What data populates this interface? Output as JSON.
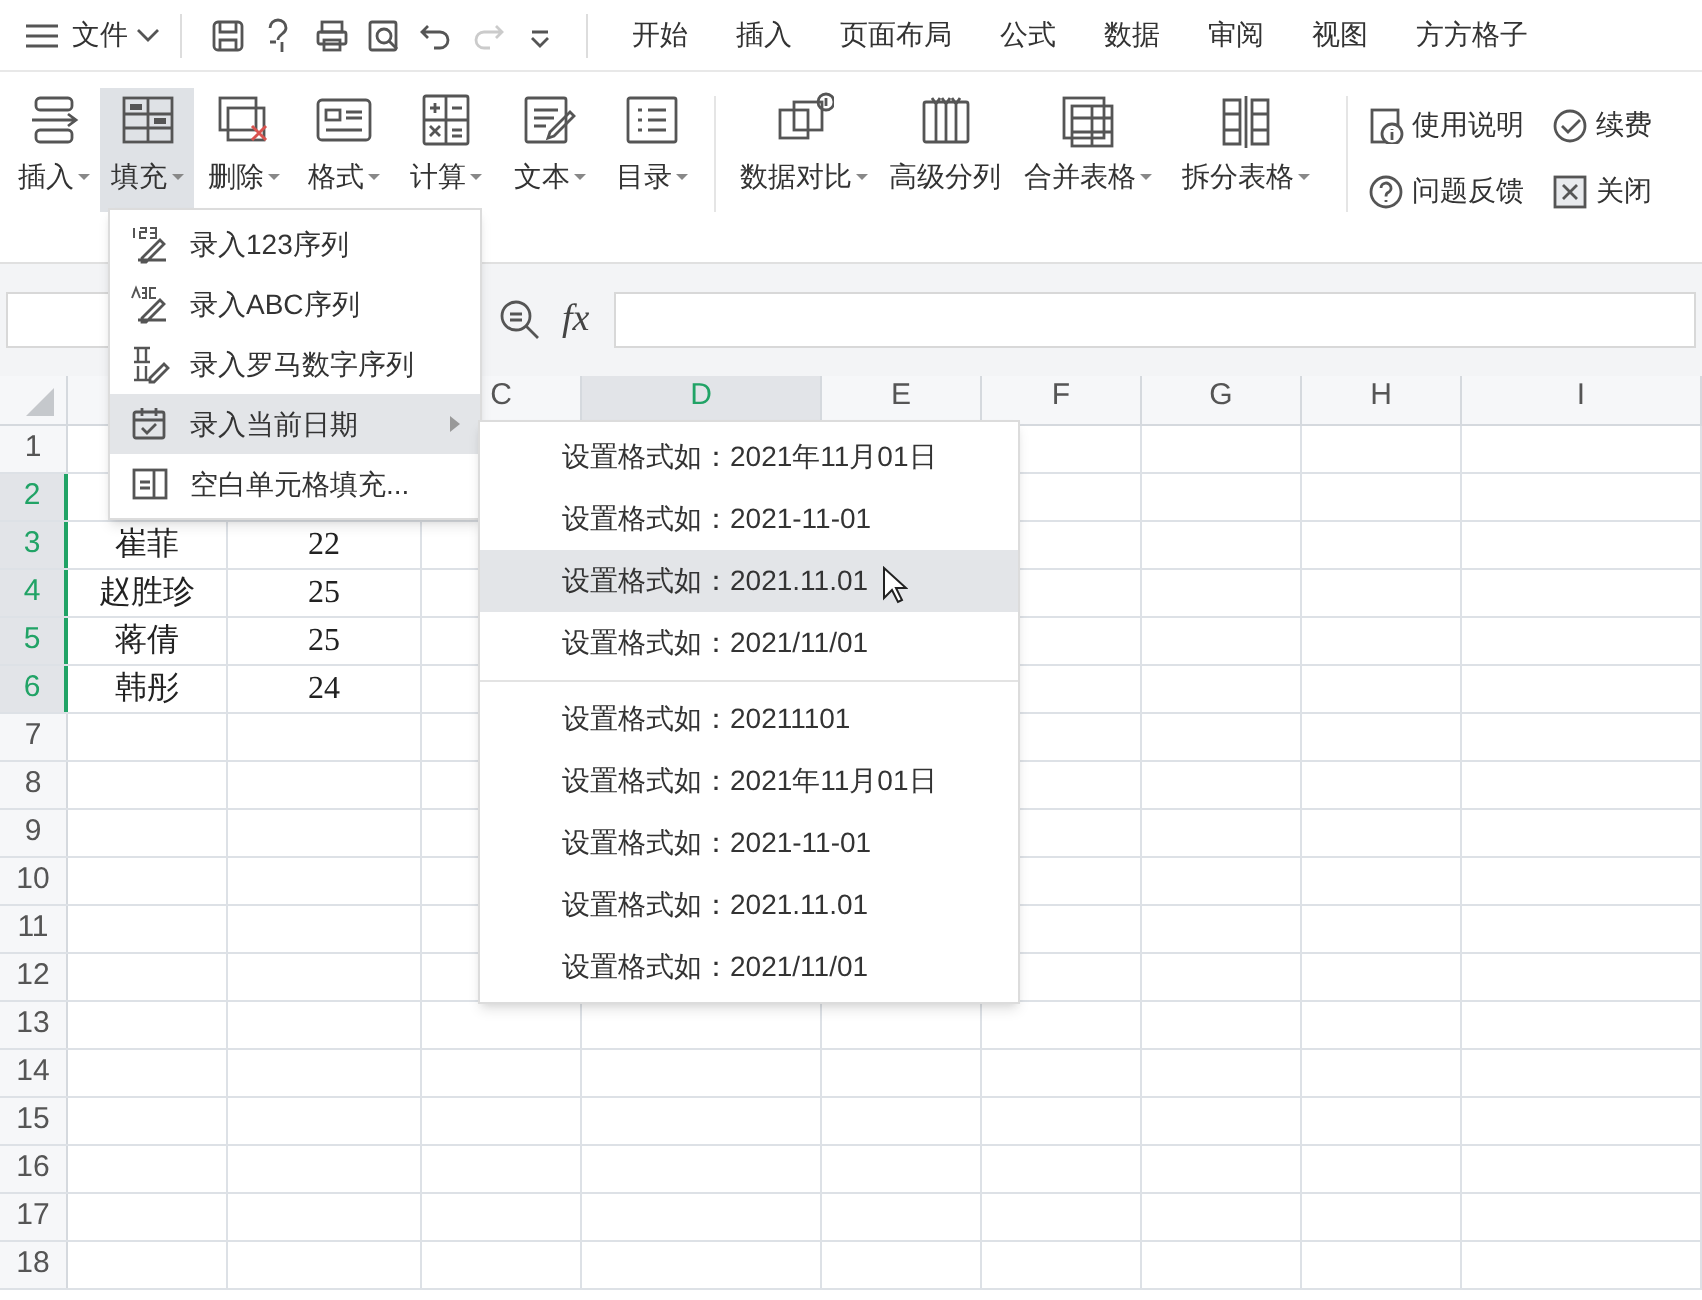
{
  "app_menu": {
    "label": "文件"
  },
  "quick_tools": [
    {
      "disabled": false
    },
    {
      "disabled": false
    },
    {
      "disabled": false
    },
    {
      "disabled": false
    },
    {
      "disabled": false
    },
    {
      "disabled": true
    },
    {
      "disabled": false
    }
  ],
  "tabs": [
    {
      "label": "开始"
    },
    {
      "label": "插入"
    },
    {
      "label": "页面布局"
    },
    {
      "label": "公式"
    },
    {
      "label": "数据"
    },
    {
      "label": "审阅"
    },
    {
      "label": "视图"
    },
    {
      "label": "方方格子"
    }
  ],
  "ribbon": {
    "buttons": [
      {
        "label": "插入",
        "dropdown": true,
        "pressed": false
      },
      {
        "label": "填充",
        "dropdown": true,
        "pressed": true
      },
      {
        "label": "删除",
        "dropdown": true,
        "pressed": false
      },
      {
        "label": "格式",
        "dropdown": true,
        "pressed": false
      },
      {
        "label": "计算",
        "dropdown": true,
        "pressed": false
      },
      {
        "label": "文本",
        "dropdown": true,
        "pressed": false
      },
      {
        "label": "目录",
        "dropdown": true,
        "pressed": false
      },
      {
        "label": "数据对比",
        "dropdown": true,
        "pressed": false
      },
      {
        "label": "高级分列",
        "dropdown": false,
        "pressed": false
      },
      {
        "label": "合并表格",
        "dropdown": true,
        "pressed": false
      },
      {
        "label": "拆分表格",
        "dropdown": true,
        "pressed": false
      }
    ],
    "small_buttons": [
      {
        "label": "使用说明"
      },
      {
        "label": "问题反馈"
      },
      {
        "label": "续费"
      },
      {
        "label": "关闭"
      }
    ]
  },
  "formula_bar": {
    "fx": "fx"
  },
  "columns": [
    {
      "label": "C",
      "selected": false
    },
    {
      "label": "D",
      "selected": true
    },
    {
      "label": "E",
      "selected": false
    },
    {
      "label": "F",
      "selected": false
    },
    {
      "label": "G",
      "selected": false
    },
    {
      "label": "H",
      "selected": false
    },
    {
      "label": "I",
      "selected": false
    }
  ],
  "rows": [
    {
      "number": "1",
      "selected": false,
      "cells": []
    },
    {
      "number": "2",
      "selected": true,
      "cells": []
    },
    {
      "number": "3",
      "selected": true,
      "cells": [
        "崔菲",
        "22"
      ]
    },
    {
      "number": "4",
      "selected": true,
      "cells": [
        "赵胜珍",
        "25"
      ]
    },
    {
      "number": "5",
      "selected": true,
      "cells": [
        "蒋倩",
        "25"
      ]
    },
    {
      "number": "6",
      "selected": true,
      "cells": [
        "韩彤",
        "24"
      ]
    },
    {
      "number": "7",
      "selected": false,
      "cells": []
    },
    {
      "number": "8",
      "selected": false,
      "cells": []
    },
    {
      "number": "9",
      "selected": false,
      "cells": []
    },
    {
      "number": "10",
      "selected": false,
      "cells": []
    },
    {
      "number": "11",
      "selected": false,
      "cells": []
    },
    {
      "number": "12",
      "selected": false,
      "cells": []
    },
    {
      "number": "13",
      "selected": false,
      "cells": []
    },
    {
      "number": "14",
      "selected": false,
      "cells": []
    },
    {
      "number": "15",
      "selected": false,
      "cells": []
    },
    {
      "number": "16",
      "selected": false,
      "cells": []
    },
    {
      "number": "17",
      "selected": false,
      "cells": []
    },
    {
      "number": "18",
      "selected": false,
      "cells": []
    }
  ],
  "fill_menu": {
    "items": [
      {
        "label": "录入123序列",
        "selected": false,
        "submenu": false
      },
      {
        "label": "录入ABC序列",
        "selected": false,
        "submenu": false
      },
      {
        "label": "录入罗马数字序列",
        "selected": false,
        "submenu": false
      },
      {
        "label": "录入当前日期",
        "selected": true,
        "submenu": true
      },
      {
        "label": "空白单元格填充...",
        "selected": false,
        "submenu": false
      }
    ]
  },
  "date_submenu": {
    "groups": [
      [
        {
          "label": "设置格式如：2021年11月01日",
          "selected": false
        },
        {
          "label": "设置格式如：2021-11-01",
          "selected": false
        },
        {
          "label": "设置格式如：2021.11.01",
          "selected": true
        },
        {
          "label": "设置格式如：2021/11/01",
          "selected": false
        }
      ],
      [
        {
          "label": "设置格式如：20211101",
          "selected": false
        },
        {
          "label": "设置格式如：2021年11月01日",
          "selected": false
        },
        {
          "label": "设置格式如：2021-11-01",
          "selected": false
        },
        {
          "label": "设置格式如：2021.11.01",
          "selected": false
        },
        {
          "label": "设置格式如：2021/11/01",
          "selected": false
        }
      ]
    ]
  }
}
